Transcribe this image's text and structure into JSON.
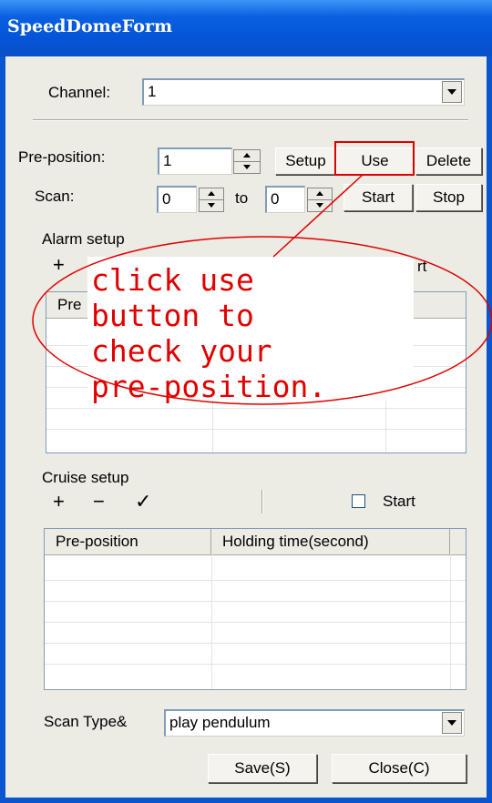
{
  "window": {
    "title": "SpeedDomeForm"
  },
  "channel": {
    "label": "Channel:",
    "value": "1"
  },
  "preposition": {
    "label": "Pre-position:",
    "value": "1",
    "setup_label": "Setup",
    "use_label": "Use",
    "delete_label": "Delete"
  },
  "scan": {
    "label": "Scan:",
    "from_value": "0",
    "to_label": "to",
    "to_value": "0",
    "start_label": "Start",
    "stop_label": "Stop"
  },
  "alarm": {
    "section_label": "Alarm setup",
    "add_icon": "+",
    "start_fragment": "rt",
    "column_fragment": "Pre"
  },
  "cruise": {
    "section_label": "Cruise setup",
    "add_icon": "+",
    "remove_icon": "−",
    "confirm_icon": "✓",
    "start_label": "Start",
    "columns": [
      "Pre-position",
      "Holding time(second)"
    ]
  },
  "scan_type": {
    "label": "Scan Type&",
    "value": "play pendulum"
  },
  "footer": {
    "save_label": "Save(S)",
    "close_label": "Close(C)"
  },
  "annotation": {
    "text": "click use\nbutton to\ncheck your\npre-position.",
    "color": "#e00000"
  }
}
